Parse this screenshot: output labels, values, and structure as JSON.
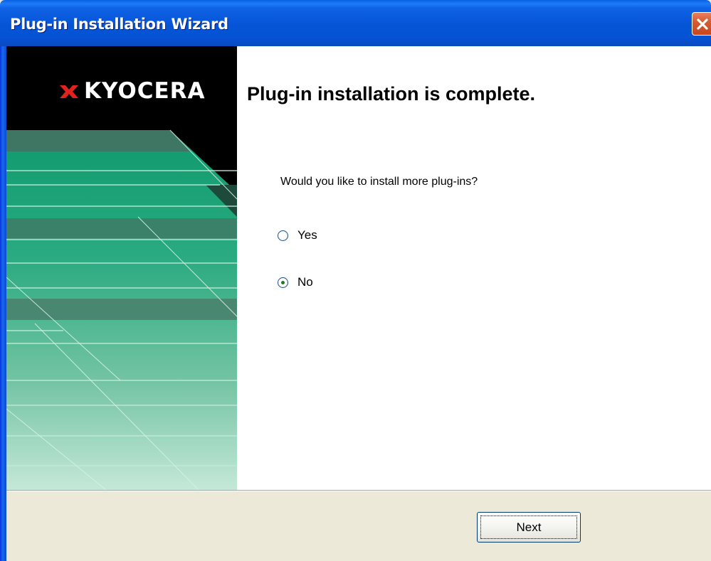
{
  "window": {
    "title": "Plug-in Installation Wizard",
    "close_icon": "close-icon"
  },
  "banner": {
    "logo_text": "KYOCERA",
    "logo_icon": "kyocera-logo-icon",
    "colors": {
      "background": "#000000",
      "teal_dark": "#2F6B57",
      "teal": "#159A72",
      "mint": "#9ED8C0"
    }
  },
  "main": {
    "heading": "Plug-in installation is complete.",
    "question": "Would you like to install more plug-ins?",
    "options": [
      {
        "label": "Yes",
        "checked": false
      },
      {
        "label": "No",
        "checked": true
      }
    ]
  },
  "footer": {
    "next_label": "Next"
  }
}
